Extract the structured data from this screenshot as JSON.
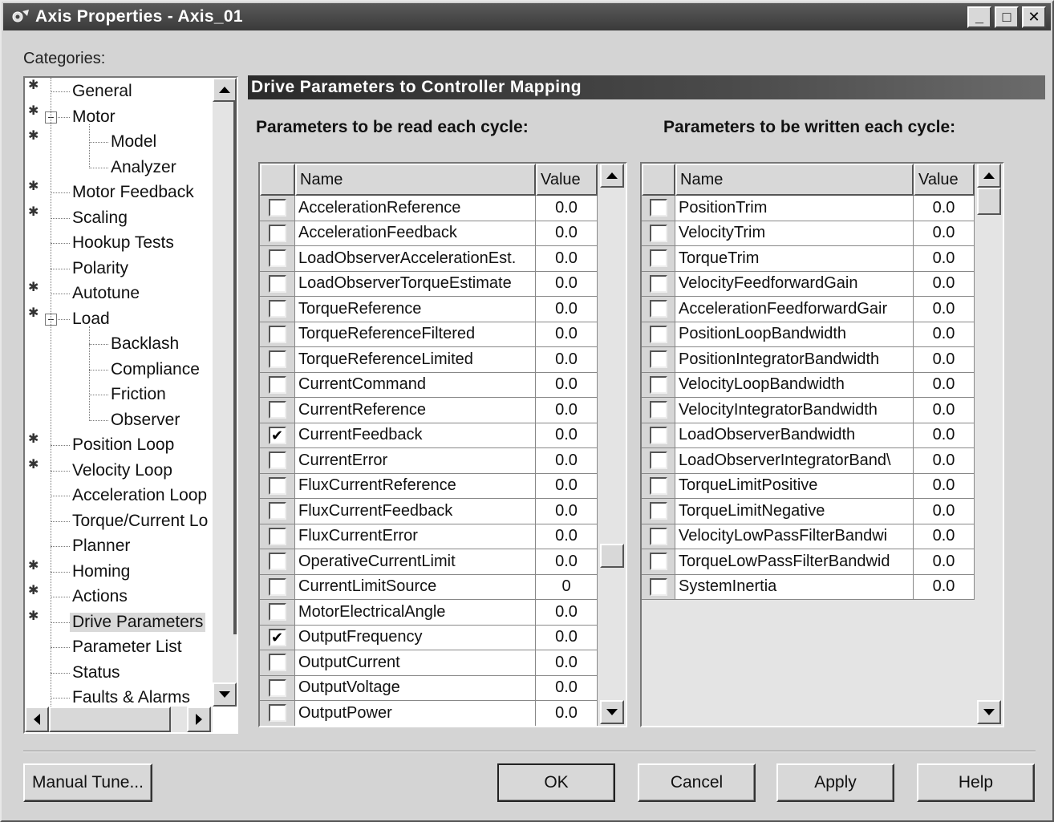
{
  "window": {
    "title": "Axis Properties - Axis_01",
    "controls": [
      "_",
      "□",
      "✕"
    ]
  },
  "categories_label": "Categories:",
  "tree": {
    "items": [
      {
        "label": "General",
        "level": 1,
        "star": true
      },
      {
        "label": "Motor",
        "level": 1,
        "star": true,
        "expander": "−"
      },
      {
        "label": "Model",
        "level": 2,
        "star": true
      },
      {
        "label": "Analyzer",
        "level": 2,
        "star": false
      },
      {
        "label": "Motor Feedback",
        "level": 1,
        "star": true
      },
      {
        "label": "Scaling",
        "level": 1,
        "star": true
      },
      {
        "label": "Hookup Tests",
        "level": 1,
        "star": false
      },
      {
        "label": "Polarity",
        "level": 1,
        "star": false
      },
      {
        "label": "Autotune",
        "level": 1,
        "star": true
      },
      {
        "label": "Load",
        "level": 1,
        "star": true,
        "expander": "−"
      },
      {
        "label": "Backlash",
        "level": 2,
        "star": false
      },
      {
        "label": "Compliance",
        "level": 2,
        "star": false
      },
      {
        "label": "Friction",
        "level": 2,
        "star": false
      },
      {
        "label": "Observer",
        "level": 2,
        "star": false
      },
      {
        "label": "Position Loop",
        "level": 1,
        "star": true
      },
      {
        "label": "Velocity Loop",
        "level": 1,
        "star": true
      },
      {
        "label": "Acceleration Loop",
        "level": 1,
        "star": false
      },
      {
        "label": "Torque/Current Lo",
        "level": 1,
        "star": false
      },
      {
        "label": "Planner",
        "level": 1,
        "star": false
      },
      {
        "label": "Homing",
        "level": 1,
        "star": true
      },
      {
        "label": "Actions",
        "level": 1,
        "star": true
      },
      {
        "label": "Drive Parameters",
        "level": 1,
        "star": true,
        "selected": true
      },
      {
        "label": "Parameter List",
        "level": 1,
        "star": false
      },
      {
        "label": "Status",
        "level": 1,
        "star": false
      },
      {
        "label": "Faults & Alarms",
        "level": 1,
        "star": false
      }
    ]
  },
  "section_title": "Drive Parameters to Controller Mapping",
  "read_group": {
    "label": "Parameters to be read each cycle:",
    "headers": {
      "name": "Name",
      "value": "Value"
    },
    "rows": [
      {
        "name": "AccelerationReference",
        "value": "0.0",
        "checked": false
      },
      {
        "name": "AccelerationFeedback",
        "value": "0.0",
        "checked": false
      },
      {
        "name": "LoadObserverAccelerationEst.",
        "value": "0.0",
        "checked": false
      },
      {
        "name": "LoadObserverTorqueEstimate",
        "value": "0.0",
        "checked": false
      },
      {
        "name": "TorqueReference",
        "value": "0.0",
        "checked": false
      },
      {
        "name": "TorqueReferenceFiltered",
        "value": "0.0",
        "checked": false
      },
      {
        "name": "TorqueReferenceLimited",
        "value": "0.0",
        "checked": false
      },
      {
        "name": "CurrentCommand",
        "value": "0.0",
        "checked": false
      },
      {
        "name": "CurrentReference",
        "value": "0.0",
        "checked": false
      },
      {
        "name": "CurrentFeedback",
        "value": "0.0",
        "checked": true
      },
      {
        "name": "CurrentError",
        "value": "0.0",
        "checked": false
      },
      {
        "name": "FluxCurrentReference",
        "value": "0.0",
        "checked": false
      },
      {
        "name": "FluxCurrentFeedback",
        "value": "0.0",
        "checked": false
      },
      {
        "name": "FluxCurrentError",
        "value": "0.0",
        "checked": false
      },
      {
        "name": "OperativeCurrentLimit",
        "value": "0.0",
        "checked": false
      },
      {
        "name": "CurrentLimitSource",
        "value": "0",
        "checked": false
      },
      {
        "name": "MotorElectricalAngle",
        "value": "0.0",
        "checked": false
      },
      {
        "name": "OutputFrequency",
        "value": "0.0",
        "checked": true
      },
      {
        "name": "OutputCurrent",
        "value": "0.0",
        "checked": false
      },
      {
        "name": "OutputVoltage",
        "value": "0.0",
        "checked": false
      },
      {
        "name": "OutputPower",
        "value": "0.0",
        "checked": false
      }
    ]
  },
  "write_group": {
    "label": "Parameters to be written each cycle:",
    "headers": {
      "name": "Name",
      "value": "Value"
    },
    "rows": [
      {
        "name": "PositionTrim",
        "value": "0.0",
        "checked": false
      },
      {
        "name": "VelocityTrim",
        "value": "0.0",
        "checked": false
      },
      {
        "name": "TorqueTrim",
        "value": "0.0",
        "checked": false
      },
      {
        "name": "VelocityFeedforwardGain",
        "value": "0.0",
        "checked": false
      },
      {
        "name": "AccelerationFeedforwardGair",
        "value": "0.0",
        "checked": false
      },
      {
        "name": "PositionLoopBandwidth",
        "value": "0.0",
        "checked": false
      },
      {
        "name": "PositionIntegratorBandwidth",
        "value": "0.0",
        "checked": false
      },
      {
        "name": "VelocityLoopBandwidth",
        "value": "0.0",
        "checked": false
      },
      {
        "name": "VelocityIntegratorBandwidth",
        "value": "0.0",
        "checked": false
      },
      {
        "name": "LoadObserverBandwidth",
        "value": "0.0",
        "checked": false
      },
      {
        "name": "LoadObserverIntegratorBand\\",
        "value": "0.0",
        "checked": false
      },
      {
        "name": "TorqueLimitPositive",
        "value": "0.0",
        "checked": false
      },
      {
        "name": "TorqueLimitNegative",
        "value": "0.0",
        "checked": false
      },
      {
        "name": "VelocityLowPassFilterBandwi",
        "value": "0.0",
        "checked": false
      },
      {
        "name": "TorqueLowPassFilterBandwid",
        "value": "0.0",
        "checked": false
      },
      {
        "name": "SystemInertia",
        "value": "0.0",
        "checked": false
      }
    ]
  },
  "buttons": {
    "manual_tune": "Manual Tune...",
    "ok": "OK",
    "cancel": "Cancel",
    "apply": "Apply",
    "help": "Help"
  },
  "icons": {
    "app": "axis-gear-icon",
    "check": "checkmark-icon"
  }
}
